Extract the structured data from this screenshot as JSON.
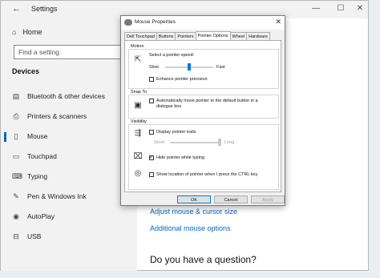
{
  "settings": {
    "title": "Settings",
    "window_controls": {
      "minimize": "—",
      "maximize": "☐",
      "close": "✕"
    },
    "home_label": "Home",
    "search_placeholder": "Find a setting",
    "section_title": "Devices",
    "nav": [
      {
        "label": "Bluetooth & other devices",
        "icon": "bluetooth-device-icon"
      },
      {
        "label": "Printers & scanners",
        "icon": "printer-icon"
      },
      {
        "label": "Mouse",
        "icon": "mouse-icon",
        "active": true
      },
      {
        "label": "Touchpad",
        "icon": "touchpad-icon"
      },
      {
        "label": "Typing",
        "icon": "keyboard-icon"
      },
      {
        "label": "Pen & Windows Ink",
        "icon": "pen-icon"
      },
      {
        "label": "AutoPlay",
        "icon": "autoplay-icon"
      },
      {
        "label": "USB",
        "icon": "usb-icon"
      }
    ],
    "links": [
      "Adjust mouse & cursor size",
      "Additional mouse options"
    ],
    "question": "Do you have a question?"
  },
  "dialog": {
    "title": "Mouse Properties",
    "tabs": [
      "Dell Touchpad",
      "Buttons",
      "Pointers",
      "Pointer Options",
      "Wheel",
      "Hardware"
    ],
    "selected_tab": "Pointer Options",
    "motion": {
      "label": "Motion",
      "speed_label": "Select a pointer speed:",
      "slow": "Slow",
      "fast": "Fast",
      "speed_level": 0.5,
      "enhance_label": "Enhance pointer precision",
      "enhance_checked": false
    },
    "snap_to": {
      "label": "Snap To",
      "option_label": "Automatically move pointer to the default button in a dialogue box",
      "checked": false
    },
    "visibility": {
      "label": "Visibility",
      "trails_label": "Display pointer trails",
      "trails_checked": false,
      "short": "Short",
      "long": "Long",
      "trail_level": 1.0,
      "hide_label": "Hide pointer while typing",
      "hide_checked": true,
      "ctrl_label": "Show location of pointer when I press the CTRL key",
      "ctrl_checked": false
    },
    "buttons": {
      "ok": "OK",
      "cancel": "Cancel",
      "apply": "Apply"
    }
  }
}
